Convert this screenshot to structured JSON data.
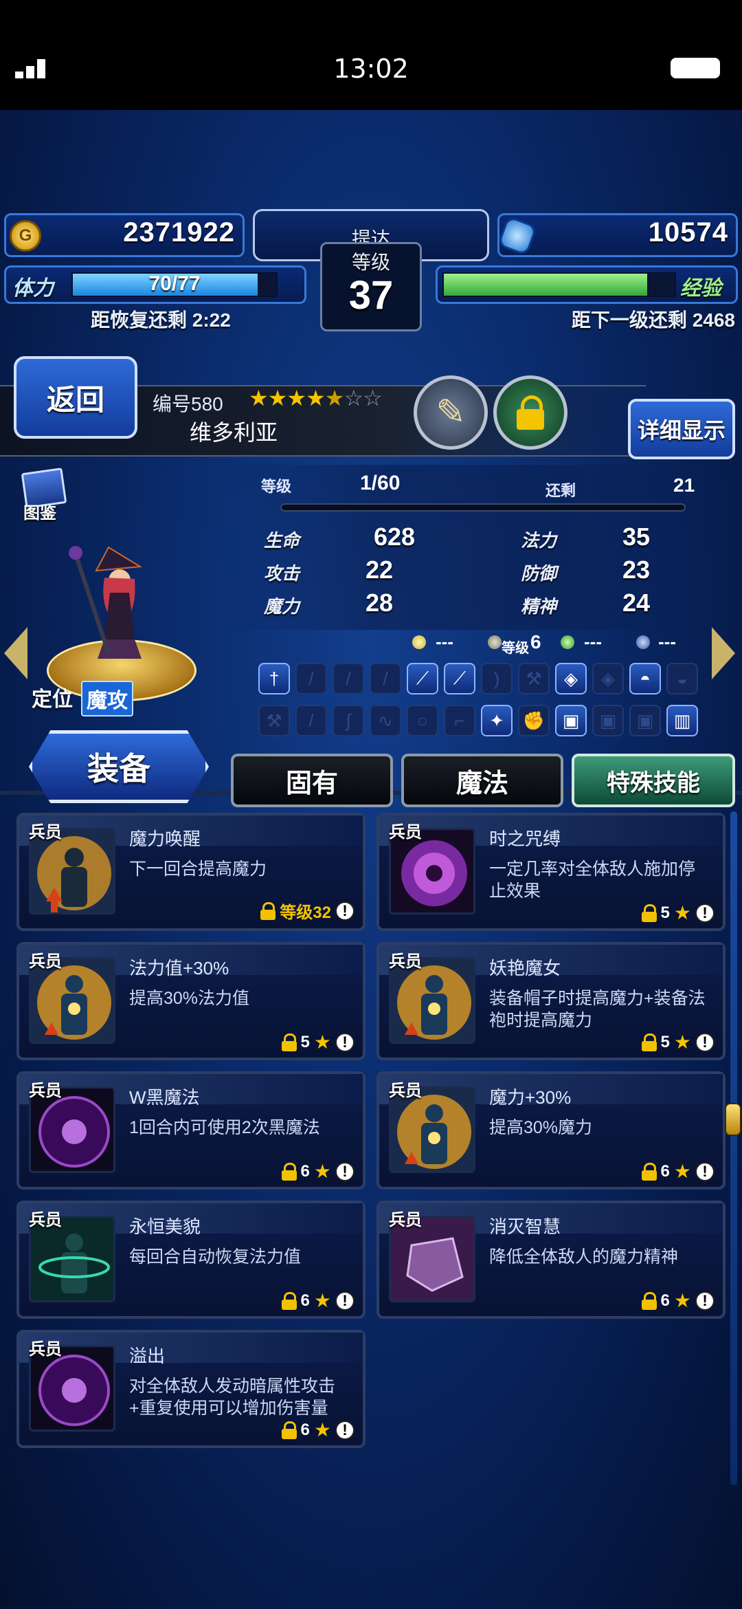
{
  "status_bar": {
    "time": "13:02"
  },
  "hud": {
    "gil": "2371922",
    "rank_label_1": "提达",
    "rank_label_2": "等级",
    "rank_level": "37",
    "lapis": "10574",
    "stamina_label": "体力",
    "stamina_value": "70/77",
    "stamina_fill": 0.909,
    "stamina_recover": "距恢复还剩 2:22",
    "exp_label": "经验",
    "exp_fill": 0.88,
    "exp_next": "距下一级还剩 2468"
  },
  "unit": {
    "back_label": "返回",
    "number": "编号580",
    "rarity_filled": 4,
    "rarity_half": 1,
    "rarity_total": 7,
    "name": "维多利亚",
    "detail_label": "详细显示",
    "encyclopedia_label": "图鉴",
    "role_label": "定位",
    "role_value": "魔攻"
  },
  "stats": {
    "level_label": "等级",
    "level_value": "1/60",
    "remaining_label": "还剩",
    "remaining_value": "21",
    "hp_label": "生命",
    "hp": "628",
    "mp_label": "法力",
    "mp": "35",
    "atk_label": "攻击",
    "atk": "22",
    "def_label": "防御",
    "def": "23",
    "mag_label": "魔力",
    "mag": "28",
    "spr_label": "精神",
    "spr": "24",
    "orb1": "---",
    "orb2_label": "等级",
    "orb2_value": "6",
    "orb3": "---",
    "orb4": "---"
  },
  "tabs": {
    "equip": "装备",
    "innate": "固有",
    "magic": "魔法",
    "special": "特殊技能"
  },
  "abilities": [
    {
      "tag": "兵员",
      "title": "魔力唤醒",
      "desc": "下一回合提高魔力",
      "req": "等级32",
      "icon": "aura-up"
    },
    {
      "tag": "兵员",
      "title": "时之咒缚",
      "desc": "一定几率对全体敌人施加停止效果",
      "req": "5",
      "icon": "purple-burst"
    },
    {
      "tag": "兵员",
      "title": "法力值+30%",
      "desc": "提高30%法力值",
      "req": "5",
      "icon": "aura-body"
    },
    {
      "tag": "兵员",
      "title": "妖艳魔女",
      "desc": "装备帽子时提高魔力+装备法袍时提高魔力",
      "req": "5",
      "icon": "aura-body"
    },
    {
      "tag": "兵员",
      "title": "W黑魔法",
      "desc": "1回合内可使用2次黑魔法",
      "req": "6",
      "icon": "dark-orb"
    },
    {
      "tag": "兵员",
      "title": "魔力+30%",
      "desc": "提高30%魔力",
      "req": "6",
      "icon": "aura-body"
    },
    {
      "tag": "兵员",
      "title": "永恒美貌",
      "desc": "每回合自动恢复法力值",
      "req": "6",
      "icon": "teal-figure"
    },
    {
      "tag": "兵员",
      "title": "消灭智慧",
      "desc": "降低全体敌人的魔力精神",
      "req": "6",
      "icon": "purple-rock"
    },
    {
      "tag": "兵员",
      "title": "溢出",
      "desc": "对全体敌人发动暗属性攻击+重复使用可以增加伤害量",
      "req": "6",
      "icon": "dark-orb"
    }
  ]
}
